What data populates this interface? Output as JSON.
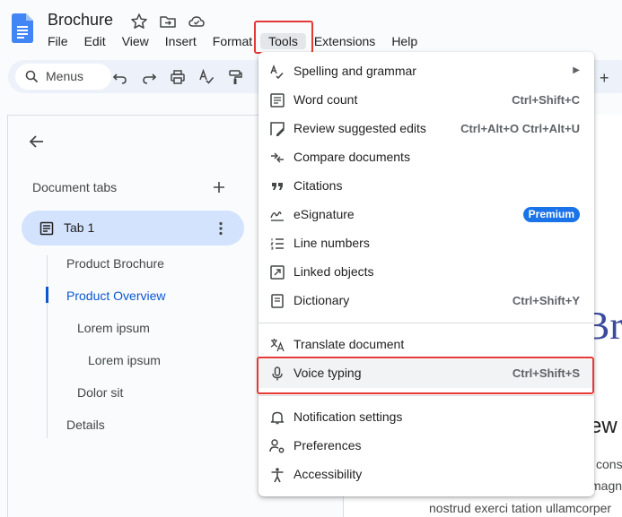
{
  "app": {
    "doc_title": "Brochure",
    "colors": {
      "accent": "#0b57d0",
      "highlight": "#e53935",
      "badge": "#1a73e8"
    }
  },
  "menubar": [
    {
      "label": "File"
    },
    {
      "label": "Edit"
    },
    {
      "label": "View"
    },
    {
      "label": "Insert"
    },
    {
      "label": "Format"
    },
    {
      "label": "Tools"
    },
    {
      "label": "Extensions"
    },
    {
      "label": "Help"
    }
  ],
  "toolbar": {
    "search_label": "Menus"
  },
  "sidepanel": {
    "header": "Document tabs",
    "tab_name": "Tab 1",
    "outline": [
      {
        "label": "Product Brochure"
      },
      {
        "label": "Product Overview"
      },
      {
        "label": "Lorem ipsum"
      },
      {
        "label": "Lorem ipsum"
      },
      {
        "label": "Dolor sit"
      },
      {
        "label": "Details"
      }
    ]
  },
  "tools_menu": {
    "items": [
      {
        "label": "Spelling and grammar",
        "icon": "spellcheck-icon"
      },
      {
        "label": "Word count",
        "shortcut": "Ctrl+Shift+C",
        "icon": "word-count-icon"
      },
      {
        "label": "Review suggested edits",
        "shortcut": "Ctrl+Alt+O Ctrl+Alt+U",
        "icon": "review-edits-icon"
      },
      {
        "label": "Compare documents",
        "icon": "compare-icon"
      },
      {
        "label": "Citations",
        "icon": "quote-icon"
      },
      {
        "label": "eSignature",
        "badge": "Premium",
        "icon": "signature-icon"
      },
      {
        "label": "Line numbers",
        "icon": "line-numbers-icon"
      },
      {
        "label": "Linked objects",
        "icon": "linked-objects-icon"
      },
      {
        "label": "Dictionary",
        "shortcut": "Ctrl+Shift+Y",
        "icon": "dictionary-icon"
      },
      {
        "label": "Translate document",
        "icon": "translate-icon"
      },
      {
        "label": "Voice typing",
        "shortcut": "Ctrl+Shift+S",
        "icon": "microphone-icon"
      },
      {
        "label": "Notification settings",
        "icon": "bell-icon"
      },
      {
        "label": "Preferences",
        "icon": "preferences-icon"
      },
      {
        "label": "Accessibility",
        "icon": "accessibility-icon"
      }
    ]
  },
  "document": {
    "heading_fragment": "Bro",
    "subheading_fragment": "ew",
    "lines": [
      "cons",
      "magna",
      "nostrud exerci tation ullamcorper"
    ]
  }
}
